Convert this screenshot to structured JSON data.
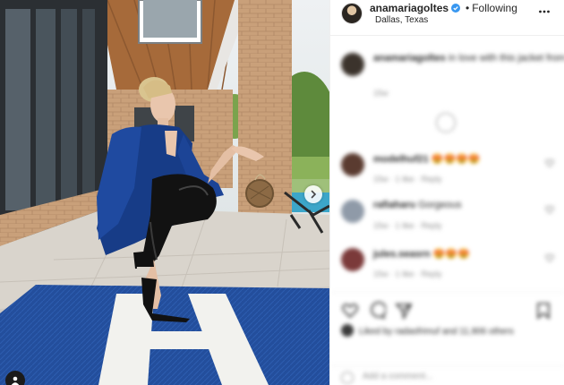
{
  "header": {
    "username": "anamariagoltes",
    "separator": "•",
    "follow_status": "Following",
    "location": "Dallas, Texas"
  },
  "comments": [
    {
      "username": "anamariagoltes",
      "text": "in love with this jacket from @saypersonal",
      "meta": "15w",
      "blurred": true
    },
    {
      "username": "modelhuf21",
      "text": "😍😍😍😍",
      "meta": "15w · 1 like · Reply",
      "blurred": true
    },
    {
      "username": "rafiaharu",
      "text": "Gorgeous",
      "meta": "15w · 1 like · Reply",
      "blurred": true
    },
    {
      "username": "jules.seasrn",
      "text": "😍😍😍",
      "meta": "15w · 1 like · Reply",
      "blurred": true
    }
  ],
  "likes": {
    "text": "Liked by radasfrimuf and 11,906 others",
    "blurred": true
  },
  "add_comment": {
    "placeholder": "Add a comment...",
    "blurred": true
  },
  "colors": {
    "verified": "#3897f0",
    "text": "#262626",
    "muted": "#8e8e8e",
    "divider": "#efefef",
    "rug": "#234e9c"
  },
  "icons": {
    "verified": "verified-badge-icon",
    "more": "more-options-icon",
    "next": "chevron-right-icon",
    "tag": "user-tag-icon",
    "like": "heart-icon",
    "comment": "comment-icon",
    "share": "paper-plane-icon",
    "save": "bookmark-icon"
  }
}
